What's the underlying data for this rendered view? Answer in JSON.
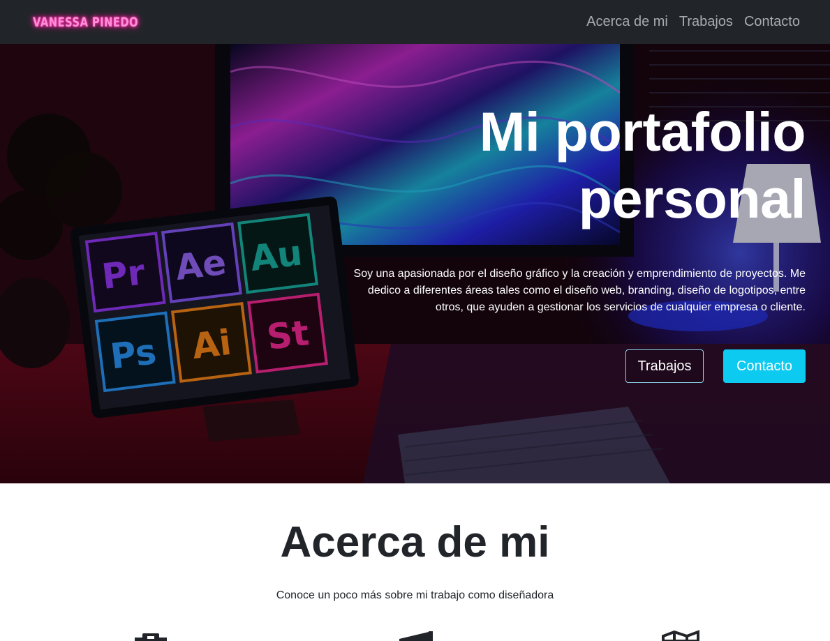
{
  "navbar": {
    "brand": "VANESSA PINEDO",
    "links": [
      "Acerca de mi",
      "Trabajos",
      "Contacto"
    ]
  },
  "hero": {
    "title_line1": "Mi portafolio",
    "title_line2": "personal",
    "description": "Soy una apasionada por el diseño gráfico y la creación y emprendimiento de proyectos. Me dedico a diferentes áreas tales como el diseño web, branding, diseño de logotipos, entre otros, que ayuden a gestionar los servicios de cualquier empresa o cliente.",
    "buttons": {
      "primary_outline": "Trabajos",
      "primary_solid": "Contacto"
    },
    "image_tiles": [
      "Pr",
      "Ae",
      "Au",
      "Ps",
      "Ai",
      "St"
    ]
  },
  "about": {
    "title": "Acerca de mi",
    "subtitle": "Conoce un poco más sobre mi trabajo como diseñadora",
    "icons": [
      "camera-icon",
      "megaphone-icon",
      "map-icon"
    ]
  },
  "colors": {
    "navbar_bg": "#212529",
    "brand_neon": "#ff2aa8",
    "accent_cyan": "#0dcaf0",
    "text_dark": "#212529"
  }
}
